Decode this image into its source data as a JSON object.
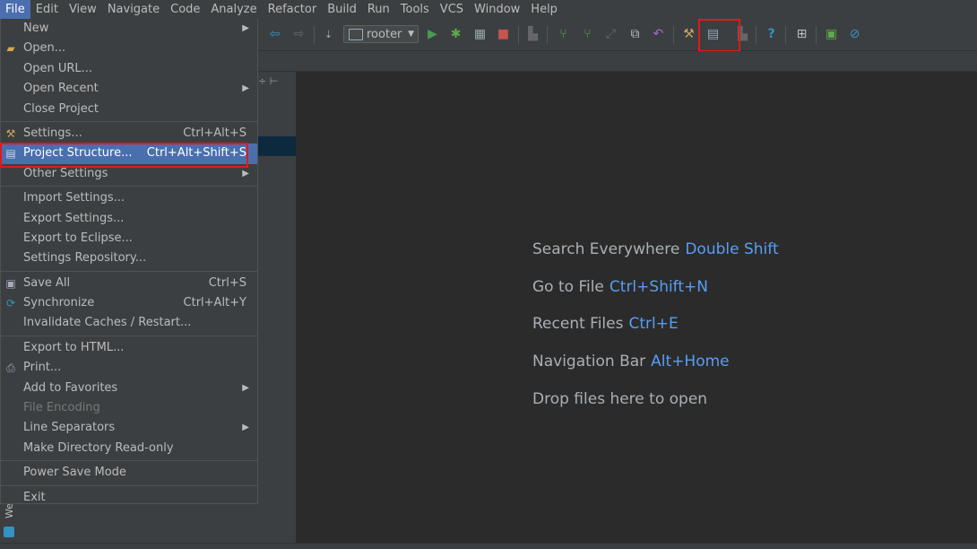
{
  "menubar": {
    "items": [
      "File",
      "Edit",
      "View",
      "Navigate",
      "Code",
      "Analyze",
      "Refactor",
      "Build",
      "Run",
      "Tools",
      "VCS",
      "Window",
      "Help"
    ]
  },
  "toolbar": {
    "run_config": "rooter"
  },
  "file_menu": {
    "items": [
      {
        "label": "New",
        "shortcut": "",
        "submenu": true,
        "icon": ""
      },
      {
        "label": "Open...",
        "shortcut": "",
        "submenu": false,
        "icon": "folder-icon"
      },
      {
        "label": "Open URL...",
        "shortcut": "",
        "submenu": false,
        "icon": ""
      },
      {
        "label": "Open Recent",
        "shortcut": "",
        "submenu": true,
        "icon": ""
      },
      {
        "label": "Close Project",
        "shortcut": "",
        "submenu": false,
        "icon": ""
      },
      {
        "sep": true
      },
      {
        "label": "Settings...",
        "shortcut": "Ctrl+Alt+S",
        "submenu": false,
        "icon": "wrench-icon"
      },
      {
        "label": "Project Structure...",
        "shortcut": "Ctrl+Alt+Shift+S",
        "submenu": false,
        "icon": "project-structure-icon",
        "selected": true
      },
      {
        "label": "Other Settings",
        "shortcut": "",
        "submenu": true,
        "icon": ""
      },
      {
        "sep": true
      },
      {
        "label": "Import Settings...",
        "shortcut": "",
        "submenu": false,
        "icon": ""
      },
      {
        "label": "Export Settings...",
        "shortcut": "",
        "submenu": false,
        "icon": ""
      },
      {
        "label": "Export to Eclipse...",
        "shortcut": "",
        "submenu": false,
        "icon": ""
      },
      {
        "label": "Settings Repository...",
        "shortcut": "",
        "submenu": false,
        "icon": ""
      },
      {
        "sep": true
      },
      {
        "label": "Save All",
        "shortcut": "Ctrl+S",
        "submenu": false,
        "icon": "save-icon"
      },
      {
        "label": "Synchronize",
        "shortcut": "Ctrl+Alt+Y",
        "submenu": false,
        "icon": "sync-icon"
      },
      {
        "label": "Invalidate Caches / Restart...",
        "shortcut": "",
        "submenu": false,
        "icon": ""
      },
      {
        "sep": true
      },
      {
        "label": "Export to HTML...",
        "shortcut": "",
        "submenu": false,
        "icon": ""
      },
      {
        "label": "Print...",
        "shortcut": "",
        "submenu": false,
        "icon": "printer-icon"
      },
      {
        "label": "Add to Favorites",
        "shortcut": "",
        "submenu": true,
        "icon": ""
      },
      {
        "label": "File Encoding",
        "shortcut": "",
        "submenu": false,
        "icon": "",
        "disabled": true
      },
      {
        "label": "Line Separators",
        "shortcut": "",
        "submenu": true,
        "icon": ""
      },
      {
        "label": "Make Directory Read-only",
        "shortcut": "",
        "submenu": false,
        "icon": ""
      },
      {
        "sep": true
      },
      {
        "label": "Power Save Mode",
        "shortcut": "",
        "submenu": false,
        "icon": ""
      },
      {
        "sep": true
      },
      {
        "label": "Exit",
        "shortcut": "",
        "submenu": false,
        "icon": ""
      }
    ]
  },
  "editor": {
    "hints": [
      {
        "label": "Search Everywhere",
        "shortcut": "Double Shift"
      },
      {
        "label": "Go to File",
        "shortcut": "Ctrl+Shift+N"
      },
      {
        "label": "Recent Files",
        "shortcut": "Ctrl+E"
      },
      {
        "label": "Navigation Bar",
        "shortcut": "Alt+Home"
      },
      {
        "label": "Drop files here to open",
        "shortcut": ""
      }
    ]
  },
  "left_strip": {
    "label": "We"
  },
  "colors": {
    "accent": "#4b6eaf",
    "highlight": "#e0191e",
    "shortcut": "#589df6"
  }
}
